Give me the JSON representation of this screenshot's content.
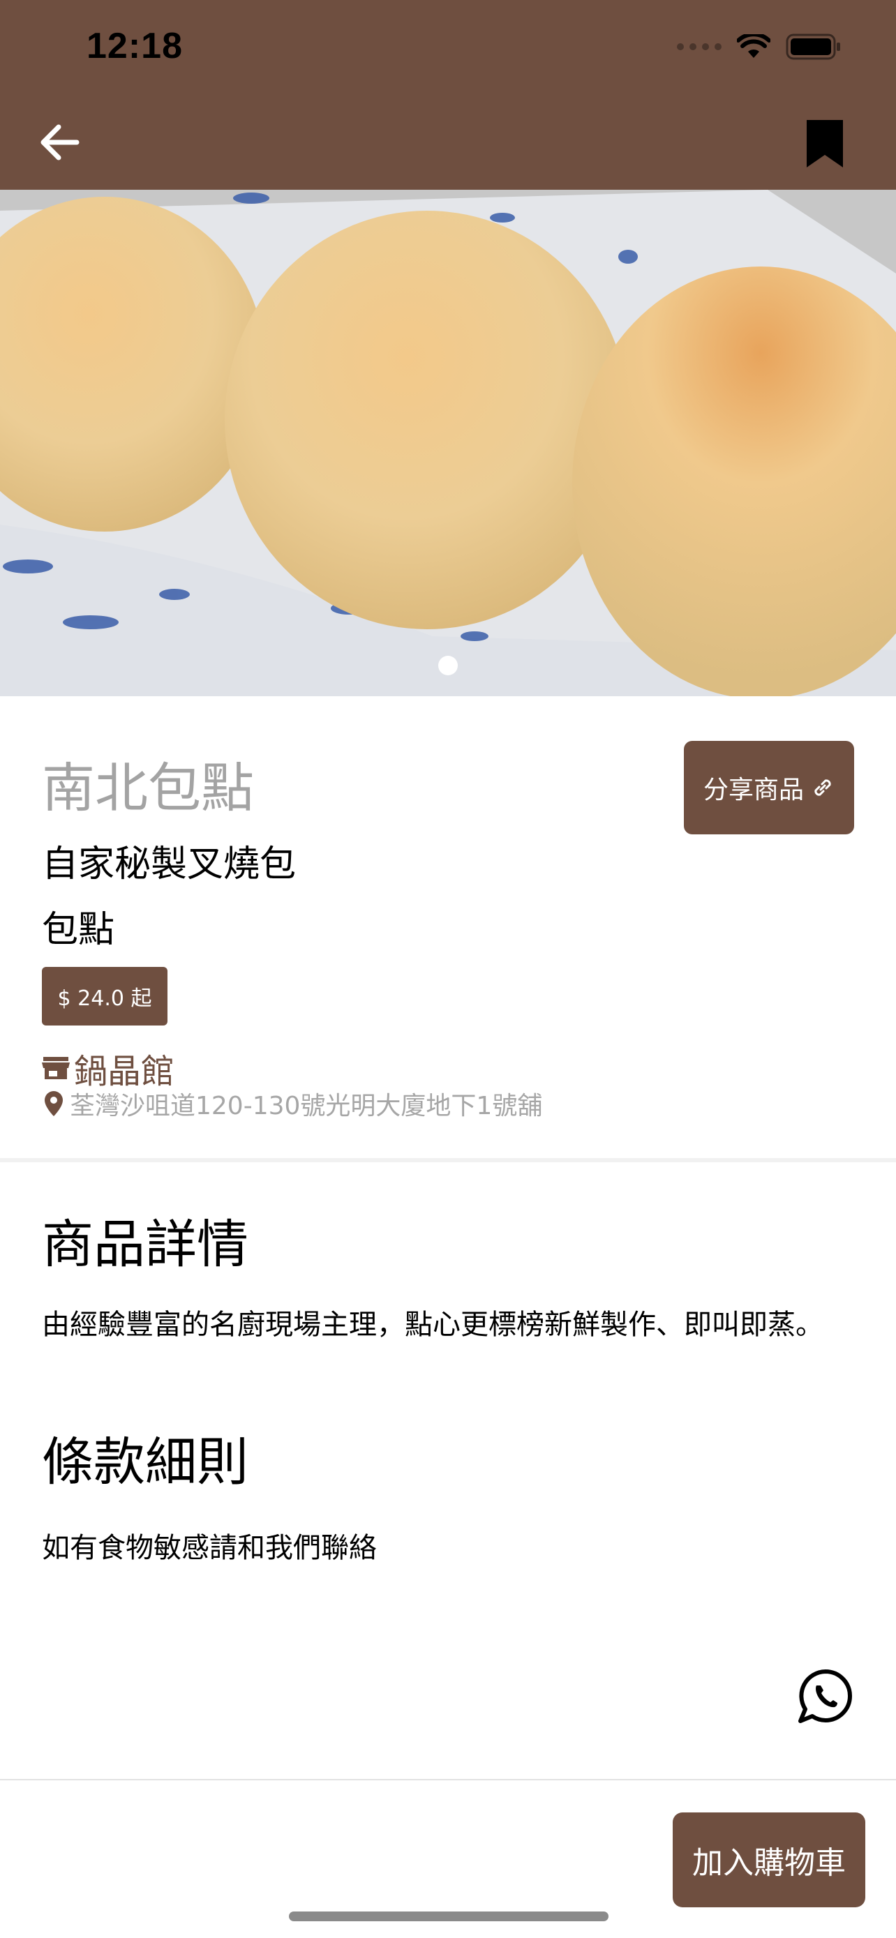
{
  "status_bar": {
    "time": "12:18"
  },
  "header": {
    "back_icon": "arrow-left-icon",
    "bookmark_icon": "bookmark-icon",
    "color": "#6f4f40"
  },
  "hero": {
    "image": "pineapple-buns-photo",
    "carousel_position": 1,
    "carousel_total": 1
  },
  "product": {
    "merchant": "南北包點",
    "name": "自家秘製叉燒包",
    "category": "包點",
    "price": "$ 24.0 起",
    "share_label": "分享商品",
    "store_name": "鍋晶館",
    "address": "荃灣沙咀道120-130號光明大廈地下1號舖"
  },
  "details": {
    "title": "商品詳情",
    "text": "由經驗豐富的名廚現場主理，點心更標榜新鮮製作、即叫即蒸。"
  },
  "terms": {
    "title": "條款細則",
    "text": "如有食物敏感請和我們聯絡"
  },
  "footer": {
    "add_to_cart": "加入購物車",
    "whatsapp_icon": "whatsapp-icon"
  }
}
